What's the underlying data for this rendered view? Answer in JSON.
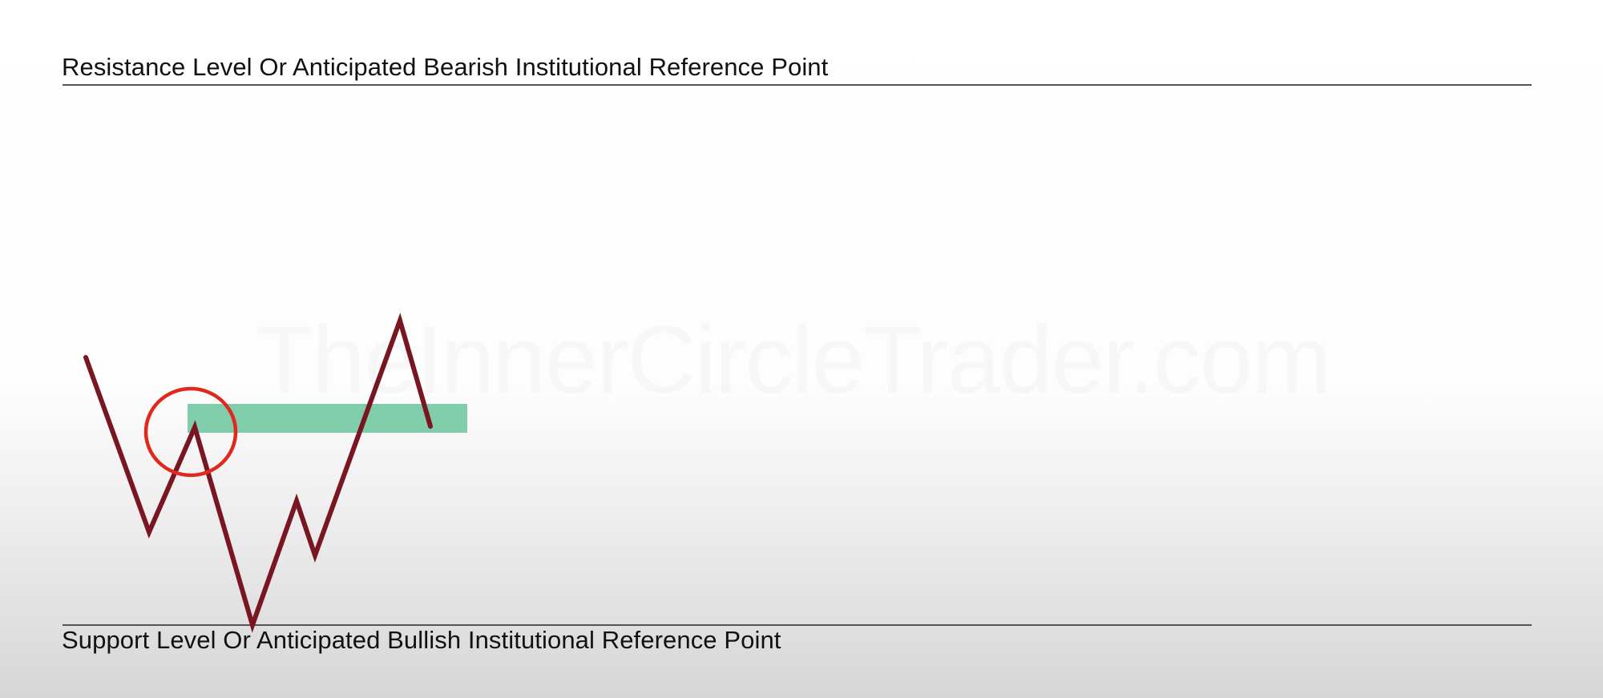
{
  "resistance": {
    "label": "Resistance Level Or Anticipated Bearish Institutional Reference Point"
  },
  "support": {
    "label": "Support Level Or Anticipated Bullish Institutional Reference Point"
  },
  "watermark": {
    "text": "TheInnerCircleTrader.com"
  },
  "colors": {
    "background_top": "#ffffff",
    "background_bottom": "#d6d6d6",
    "level_line": "#555555",
    "price_path": "#7a1522",
    "zone_fill": "#5cc095",
    "highlight_circle": "#e0281e",
    "text": "#111111"
  }
}
